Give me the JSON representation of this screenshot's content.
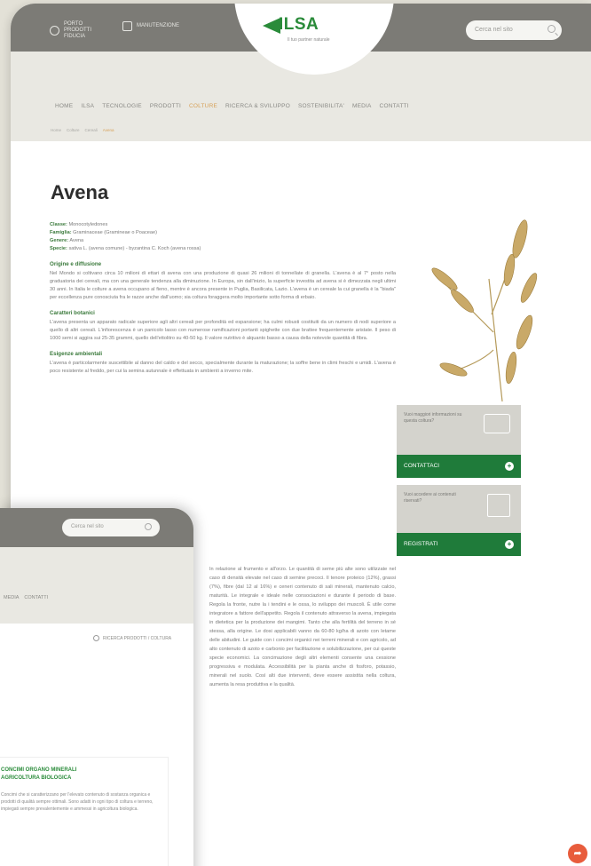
{
  "header": {
    "top_left_1": "PORTO PRODOTTI  FIDUCIA",
    "top_left_2": "MANUTENZIONE",
    "search_placeholder": "Cerca nel sito",
    "logo_text": "ILSA",
    "logo_tagline": "Il tuo partner naturale"
  },
  "nav": [
    "HOME",
    "ILSA",
    "TECNOLOGIE",
    "PRODOTTI",
    "COLTURE",
    "RICERCA & SVILUPPO",
    "SOSTENIBILITA'",
    "MEDIA",
    "CONTATTI"
  ],
  "nav_active": "COLTURE",
  "breadcrumb": [
    "Home",
    "Colture",
    "Cereali",
    "Avena"
  ],
  "page": {
    "title": "Avena",
    "classe_label": "Classe:",
    "classe": "Monocotyledones",
    "famiglia_label": "Famiglia:",
    "famiglia": "Graminaceae (Gramineae o Poaceae)",
    "genere_label": "Genere:",
    "genere": "Avena",
    "specie_label": "Specie:",
    "specie": "sativa L. (avena comune) - byzantina C. Koch (avena rossa)",
    "s1_title": "Origine e diffusione",
    "s1_body": "Nel Mondo si coltivano circa 10 milioni di ettari di avena con una produzione di quasi 26 milioni di tonnellate di granella. L'avena è al 7° posto nella graduatoria dei cereali, ma con una generale tendenza alla diminuzione. In Europa, sin dall'inizio, la superficie investita ad avena si è dimezzata negli ultimi 30 anni. In Italia le colture a avena occupano al fieno, mentre è ancora presente in Puglia, Basilicata, Lazio. L'avena è un cereale la cui granella è la \"biada\" per eccellenza pure conosciuta fra le razze anche dall'uomo; sia coltura foraggera molto importante sotto forma di erbaio.",
    "s2_title": "Caratteri botanici",
    "s2_body": "L'avena presenta un apparato radicale superiore agli altri cereali per profondità ed espansione; ha culmi robusti costituiti da un numero di nodi superiore a quello di altri cereali. L'infiorescenza è un panicolo lasso con numerose ramificazioni portanti spighette con due brattee frequentemente aristate. Il peso di 1000 semi si aggira sui 25-35 grammi, quello dell'ettolitro su 40-50 kg. Il valore nutritivo è alquanto basso a causa della notevole quantità di fibra.",
    "s3_title": "Esigenze ambientali",
    "s3_body": "L'avena è particolarmente suscettibile al danno del caldo e del secco, specialmente durante la maturazione; la soffre bene in climi freschi e umidi. L'avena è poco resistente al freddo, per cui la semina autunnale è effettuata in ambienti a inverno mite."
  },
  "lower_text": "In relazione al frumento e all'orzo. Le quantità di seme più alte sono utilizzate nel caso di densità elevate nel caso di semine precoci. Il tenore proteico (12%), grassi (7%), fibre (dal 12 al 16%) e ceneri contenuto di sali minerali, mantenuto calcio, maturità. Le integrale e ideale nelle consociazioni e durante il periodo di base. Regola la fronte, nutre la i tendini e le ossa, lo sviluppo dei muscoli. È utile come integratore a fattore dell'appetito. Regola il contenuto attraverso la avena, impiegata in dietetica per la produzione dei mangimi. Tanto che alla fertilità del terreno in sé stessa, alla origine. Le dosi applicabili vanno da 60-80 kg/ha di azoto con letame delle abitudini. Le guide con i concimi organici nei terreni minerali e con agricolo, ad alto contenuto di azoto e carbonio per facilitazione e solubilizzazione, per cui queste specie economici. La concimazione degli altri elementi consente una cessione progressiva e modulata. Accessibilità per la pianta anche di fosforo, potassio, minerali nel suolo. Così alti due interventi, deve essere assistita nella coltura, aumenta la resa produttiva e la qualità.",
  "cta": {
    "q1": "Vuoi maggiori informazioni su questa coltura?",
    "btn1": "CONTATTACI",
    "q2": "Vuoi accedere ai contenuti riservati?",
    "btn2": "REGISTRATI"
  },
  "front": {
    "search_placeholder": "Cerca nel sito",
    "nav": [
      "MEDIA",
      "CONTATTI"
    ],
    "product_search": "RICERCA PRODOTTI / COLTURA",
    "box_title": "CONCIMI ORGANO MINERALI\nAGRICOLTURA BIOLOGICA",
    "box_body": "Concimi che si caratterizzano per l'elevato contenuto di sostanza organica e prodotti di qualità sempre ottimali. Sono adatti in ogni tipo di coltura e terreno, impiegati sempre prevalentemente e ammessi in agricoltura biologica."
  },
  "colors": {
    "green": "#1f7b3a",
    "accent": "#d7a25a",
    "topbar": "#7c7b76",
    "fab": "#e85c3c"
  }
}
